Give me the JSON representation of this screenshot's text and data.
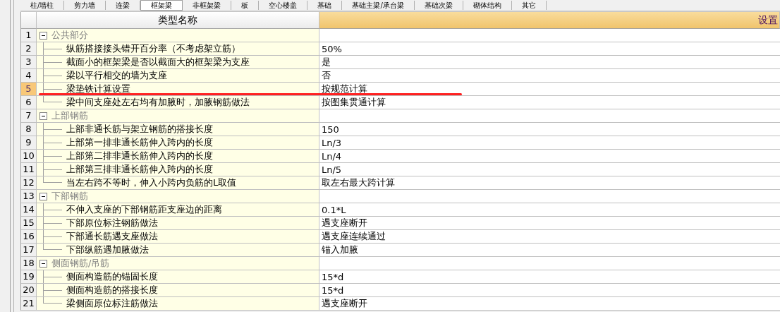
{
  "tabs": [
    {
      "label": "柱/墙柱",
      "selected": false
    },
    {
      "label": "剪力墙",
      "selected": false
    },
    {
      "label": "连梁",
      "selected": false
    },
    {
      "label": "框架梁",
      "selected": true
    },
    {
      "label": "非框架梁",
      "selected": false
    },
    {
      "label": "板",
      "selected": false
    },
    {
      "label": "空心楼盖",
      "selected": false
    },
    {
      "label": "基础",
      "selected": false
    },
    {
      "label": "基础主梁/承台梁",
      "selected": false
    },
    {
      "label": "基础次梁",
      "selected": false
    },
    {
      "label": "砌体结构",
      "selected": false
    },
    {
      "label": "其它",
      "selected": false
    }
  ],
  "table": {
    "columns": [
      "类型名称",
      "设置"
    ],
    "groups": [
      {
        "number": "1",
        "name": "公共部分",
        "expanded": true,
        "children": [
          {
            "number": "2",
            "name": "纵筋搭接接头错开百分率（不考虑架立筋）",
            "value": "50%",
            "selected": false
          },
          {
            "number": "3",
            "name": "截面小的框架梁是否以截面大的框架梁为支座",
            "value": "是",
            "selected": false
          },
          {
            "number": "4",
            "name": "梁以平行相交的墙为支座",
            "value": "否",
            "selected": false
          },
          {
            "number": "5",
            "name": "梁垫铁计算设置",
            "value": "按规范计算",
            "selected": true
          },
          {
            "number": "6",
            "name": "梁中间支座处左右均有加腋时，加腋钢筋做法",
            "value": "按图集贯通计算",
            "selected": false
          }
        ]
      },
      {
        "number": "7",
        "name": "上部钢筋",
        "expanded": true,
        "children": [
          {
            "number": "8",
            "name": "上部非通长筋与架立钢筋的搭接长度",
            "value": "150",
            "selected": false
          },
          {
            "number": "9",
            "name": "上部第一排非通长筋伸入跨内的长度",
            "value": "Ln/3",
            "selected": false
          },
          {
            "number": "10",
            "name": "上部第二排非通长筋伸入跨内的长度",
            "value": "Ln/4",
            "selected": false
          },
          {
            "number": "11",
            "name": "上部第三排非通长筋伸入跨内的长度",
            "value": "Ln/5",
            "selected": false
          },
          {
            "number": "12",
            "name": "当左右跨不等时，伸入小跨内负筋的L取值",
            "value": "取左右最大跨计算",
            "selected": false
          }
        ]
      },
      {
        "number": "13",
        "name": "下部钢筋",
        "expanded": true,
        "children": [
          {
            "number": "14",
            "name": "不伸入支座的下部钢筋距支座边的距离",
            "value": "0.1*L",
            "selected": false
          },
          {
            "number": "15",
            "name": "下部原位标注钢筋做法",
            "value": "遇支座断开",
            "selected": false
          },
          {
            "number": "16",
            "name": "下部通长筋遇支座做法",
            "value": "遇支座连续通过",
            "selected": false
          },
          {
            "number": "17",
            "name": "下部纵筋遇加腋做法",
            "value": "锚入加腋",
            "selected": false
          }
        ]
      },
      {
        "number": "18",
        "name": "侧面钢筋/吊筋",
        "expanded": true,
        "children": [
          {
            "number": "19",
            "name": "侧面构造筋的锚固长度",
            "value": "15*d",
            "selected": false
          },
          {
            "number": "20",
            "name": "侧面构造筋的搭接长度",
            "value": "15*d",
            "selected": false
          },
          {
            "number": "21",
            "name": "梁侧面原位标注筋做法",
            "value": "遇支座断开",
            "selected": false
          }
        ]
      }
    ]
  }
}
